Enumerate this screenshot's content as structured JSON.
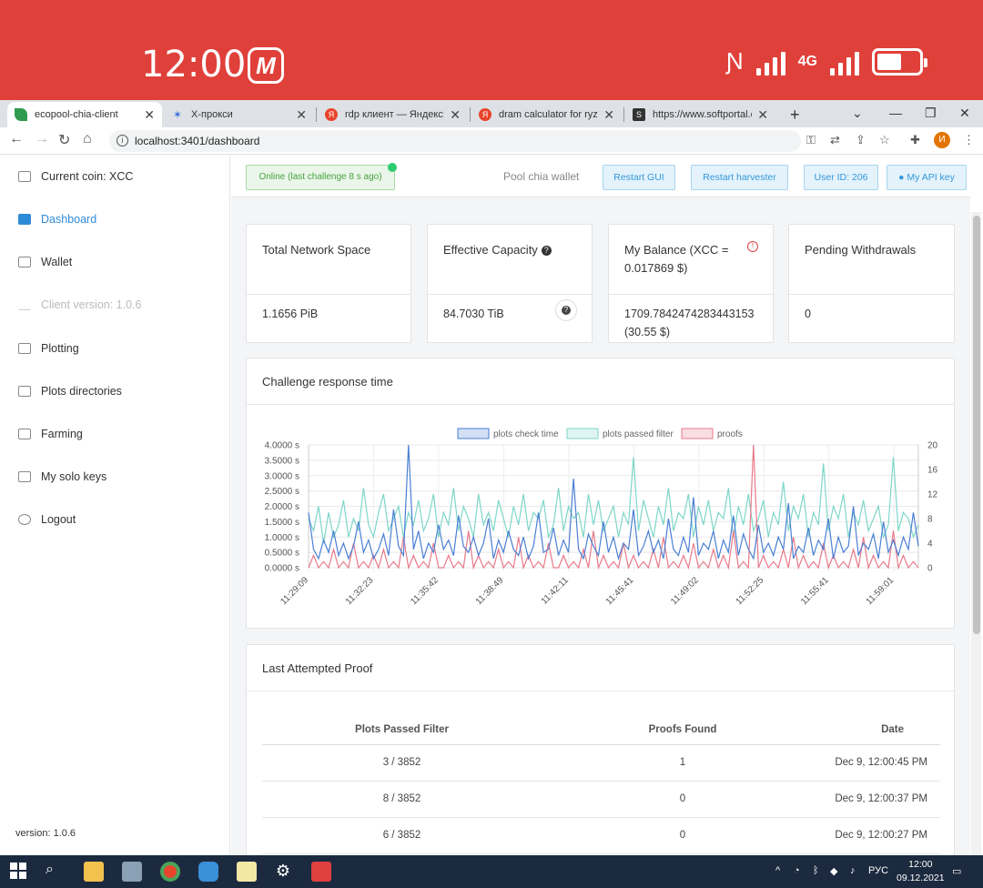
{
  "phone": {
    "time": "12:00",
    "network": "4G"
  },
  "tabs": [
    {
      "title": "ecopool-chia-client",
      "color": "#2e9b4f"
    },
    {
      "title": "X-прокси",
      "color": "#3b6fd8"
    },
    {
      "title": "rdp клиент — Яндекс: на",
      "color": "#e8452c"
    },
    {
      "title": "dram calculator for ryzen",
      "color": "#e8452c"
    },
    {
      "title": "https://www.softportal.co",
      "color": "#333333"
    }
  ],
  "address": {
    "url": "localhost:3401/dashboard",
    "avatar": "И"
  },
  "sidebar": {
    "items": [
      {
        "label": "Current coin: XCC",
        "state": "normal"
      },
      {
        "label": "Dashboard",
        "state": "active"
      },
      {
        "label": "Wallet",
        "state": "normal"
      },
      {
        "label": "Client version: 1.0.6",
        "state": "disabled"
      },
      {
        "label": "Plotting",
        "state": "normal"
      },
      {
        "label": "Plots directories",
        "state": "normal"
      },
      {
        "label": "Farming",
        "state": "normal"
      },
      {
        "label": "My solo keys",
        "state": "normal"
      },
      {
        "label": "Logout",
        "state": "normal"
      }
    ],
    "version": "version: 1.0.6"
  },
  "topbar": {
    "status": "Online (last challenge 8 s ago)",
    "pool_label": "Pool chia wallet",
    "restart_gui": "Restart GUI",
    "restart_harvester": "Restart harvester",
    "user_id": "User ID: 206",
    "api_key": "My API key"
  },
  "stats": {
    "network_space": {
      "title": "Total Network Space",
      "value": "1.1656 PiB"
    },
    "capacity": {
      "title": "Effective Capacity",
      "value": "84.7030 TiB"
    },
    "balance": {
      "title": "My Balance (XCC = 0.017869 $)",
      "value": "1709.7842474283443153 (30.55 $)"
    },
    "withdrawals": {
      "title": "Pending Withdrawals",
      "value": "0"
    }
  },
  "challenge": {
    "title": "Challenge response time"
  },
  "chart_data": {
    "type": "line",
    "legend": [
      "plots check time",
      "plots passed filter",
      "proofs"
    ],
    "colors": {
      "check": "#4a7fd4",
      "passed": "#7ed6c9",
      "proofs": "#e97a8a"
    },
    "y_left_ticks": [
      "4.0000 s",
      "3.5000 s",
      "3.0000 s",
      "2.5000 s",
      "2.0000 s",
      "1.5000 s",
      "1.0000 s",
      "0.5000 s",
      "0.0000 s"
    ],
    "y_right_ticks": [
      "20",
      "16",
      "12",
      "8",
      "4",
      "0"
    ],
    "x_ticks": [
      "11:29:09",
      "11:32:23",
      "11:35:42",
      "11:38:49",
      "11:42:11",
      "11:45:41",
      "11:49:02",
      "11:52:25",
      "11:55:41",
      "11:59:01"
    ],
    "ylim_left": [
      0,
      4
    ],
    "ylim_right": [
      0,
      20
    ],
    "series": [
      {
        "name": "plots check time",
        "axis": "left",
        "values": [
          1.8,
          0.6,
          0.3,
          0.9,
          0.5,
          1.2,
          0.4,
          0.8,
          0.3,
          0.7,
          1.5,
          0.5,
          0.9,
          0.3,
          0.6,
          1.1,
          0.4,
          1.9,
          0.7,
          0.4,
          4.0,
          0.6,
          1.2,
          0.3,
          0.8,
          0.5,
          1.4,
          0.6,
          0.9,
          0.4,
          1.7,
          0.7,
          0.5,
          1.0,
          0.4,
          0.8,
          1.6,
          0.3,
          0.9,
          0.5,
          1.2,
          0.6,
          0.4,
          1.0,
          0.3,
          0.7,
          1.8,
          0.5,
          0.6,
          1.3,
          0.4,
          0.9,
          0.5,
          2.9,
          0.6,
          0.3,
          1.1,
          0.7,
          0.4,
          1.5,
          0.5,
          1.0,
          0.3,
          0.8,
          0.6,
          1.9,
          0.4,
          0.7,
          1.2,
          0.5,
          0.9,
          0.3,
          1.6,
          0.6,
          0.4,
          1.0,
          0.5,
          2.3,
          0.4,
          0.8,
          0.6,
          1.2,
          0.3,
          0.9,
          0.5,
          1.7,
          0.4,
          1.1,
          0.6,
          0.3,
          1.4,
          0.5,
          0.8,
          0.4,
          1.0,
          0.6,
          2.1,
          0.3,
          0.7,
          0.5,
          1.3,
          0.4,
          0.9,
          0.6,
          1.6,
          0.3,
          1.0,
          0.5,
          0.7,
          2.0,
          0.4,
          0.8,
          0.6,
          1.1,
          0.3,
          1.5,
          0.5,
          0.9,
          0.4,
          1.0,
          0.6,
          1.8,
          0.7
        ]
      },
      {
        "name": "plots passed filter",
        "axis": "right",
        "values": [
          8,
          6,
          10,
          4,
          9,
          5,
          7,
          11,
          5,
          8,
          6,
          13,
          7,
          5,
          9,
          12,
          6,
          8,
          10,
          5,
          9,
          7,
          11,
          6,
          8,
          12,
          5,
          9,
          7,
          13,
          6,
          10,
          8,
          5,
          12,
          7,
          9,
          6,
          11,
          8,
          5,
          10,
          7,
          12,
          6,
          9,
          8,
          11,
          5,
          7,
          13,
          6,
          10,
          8,
          9,
          5,
          12,
          7,
          11,
          6,
          8,
          10,
          5,
          9,
          7,
          18,
          6,
          11,
          8,
          5,
          10,
          7,
          13,
          6,
          9,
          8,
          12,
          5,
          10,
          7,
          11,
          6,
          9,
          8,
          13,
          5,
          10,
          7,
          12,
          6,
          8,
          11,
          5,
          9,
          7,
          14,
          6,
          10,
          8,
          12,
          5,
          9,
          7,
          17,
          6,
          10,
          8,
          12,
          5,
          9,
          7,
          11,
          6,
          8,
          10,
          5,
          7,
          18,
          6,
          9,
          8,
          5,
          7
        ]
      },
      {
        "name": "proofs",
        "axis": "right",
        "values": [
          0,
          2,
          0,
          1,
          0,
          3,
          0,
          1,
          0,
          4,
          0,
          1,
          0,
          2,
          0,
          3,
          0,
          1,
          0,
          5,
          0,
          2,
          0,
          1,
          0,
          4,
          0,
          0,
          2,
          0,
          1,
          0,
          6,
          0,
          2,
          0,
          1,
          0,
          3,
          0,
          1,
          0,
          5,
          0,
          2,
          0,
          1,
          0,
          4,
          0,
          0,
          2,
          0,
          1,
          0,
          3,
          0,
          6,
          0,
          2,
          0,
          1,
          0,
          4,
          0,
          2,
          0,
          1,
          0,
          3,
          0,
          5,
          0,
          1,
          0,
          2,
          0,
          4,
          0,
          1,
          0,
          3,
          0,
          2,
          0,
          6,
          0,
          1,
          0,
          20,
          0,
          2,
          0,
          1,
          0,
          3,
          0,
          5,
          0,
          2,
          0,
          1,
          0,
          4,
          0,
          2,
          0,
          1,
          0,
          3,
          0,
          5,
          0,
          2,
          0,
          1,
          0,
          6,
          0,
          2,
          0,
          1,
          0
        ]
      }
    ]
  },
  "proof": {
    "title": "Last Attempted Proof",
    "columns": [
      "Plots Passed Filter",
      "Proofs Found",
      "Date"
    ],
    "rows": [
      [
        "3 / 3852",
        "1",
        "Dec 9, 12:00:45 PM"
      ],
      [
        "8 / 3852",
        "0",
        "Dec 9, 12:00:37 PM"
      ],
      [
        "6 / 3852",
        "0",
        "Dec 9, 12:00:27 PM"
      ]
    ]
  },
  "taskbar": {
    "lang": "РУС",
    "time": "12:00",
    "date": "09.12.2021"
  }
}
